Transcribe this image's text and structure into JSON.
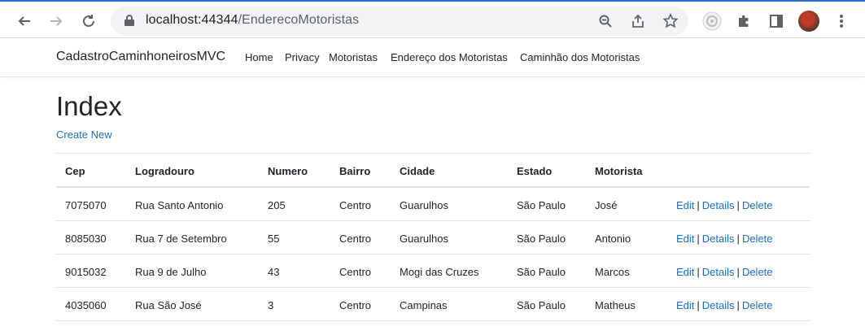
{
  "browser": {
    "url_host": "localhost:44344",
    "url_path": "/EnderecoMotoristas"
  },
  "site": {
    "brand": "CadastroCaminhoneirosMVC",
    "nav": [
      {
        "label": "Home"
      },
      {
        "label": "Privacy"
      },
      {
        "label": "Motoristas"
      },
      {
        "label": "Endereço dos Motoristas"
      },
      {
        "label": "Caminhão dos Motoristas"
      }
    ]
  },
  "page": {
    "title": "Index",
    "create_new": "Create New"
  },
  "table": {
    "headers": [
      "Cep",
      "Logradouro",
      "Numero",
      "Bairro",
      "Cidade",
      "Estado",
      "Motorista"
    ],
    "rows": [
      [
        "7075070",
        "Rua Santo Antonio",
        "205",
        "Centro",
        "Guarulhos",
        "São Paulo",
        "José"
      ],
      [
        "8085030",
        "Rua 7 de Setembro",
        "55",
        "Centro",
        "Guarulhos",
        "São Paulo",
        "Antonio"
      ],
      [
        "9015032",
        "Rua 9 de Julho",
        "43",
        "Centro",
        "Mogi das Cruzes",
        "São Paulo",
        "Marcos"
      ],
      [
        "4035060",
        "Rua São José",
        "3",
        "Centro",
        "Campinas",
        "São Paulo",
        "Matheus"
      ]
    ],
    "actions": {
      "edit": "Edit",
      "details": "Details",
      "delete": "Delete",
      "separator": "|"
    }
  }
}
